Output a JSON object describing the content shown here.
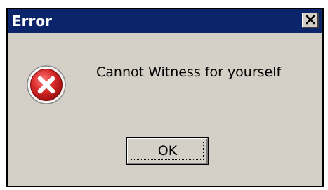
{
  "dialog": {
    "title": "Error",
    "message": "Cannot Witness for yourself",
    "ok_label": "OK",
    "close_icon": "close-icon",
    "status_icon": "error-icon"
  },
  "colors": {
    "titlebar": "#0b246a",
    "title_text": "#ffffff",
    "window_bg": "#d4d0c8",
    "icon_red": "#c8232d"
  }
}
